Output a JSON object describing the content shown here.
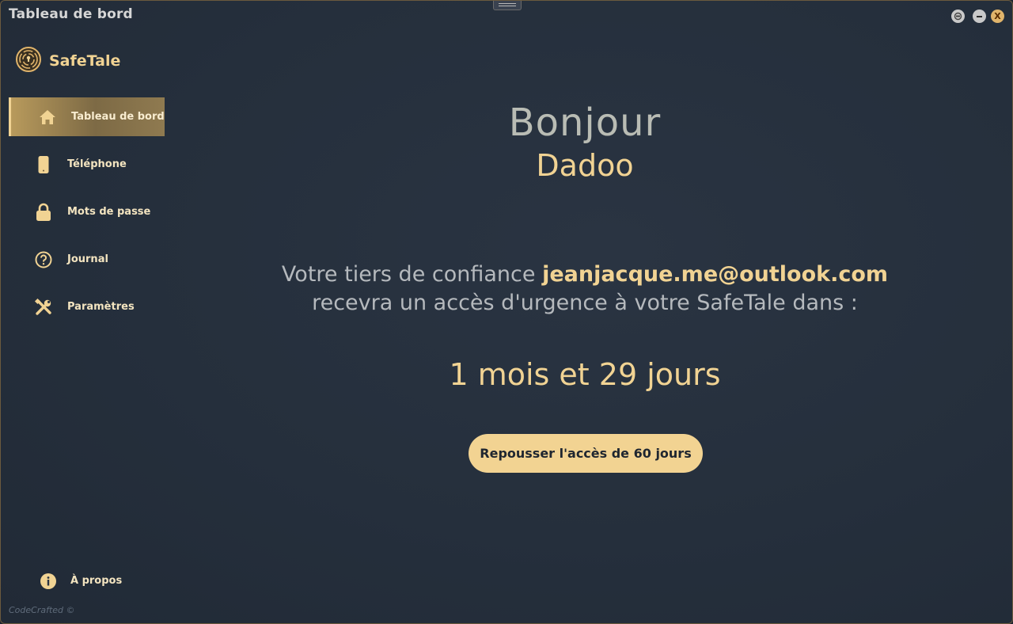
{
  "window": {
    "title": "Tableau de bord",
    "controls": {
      "extra_icon": "app-icon",
      "minimize_icon": "minimize-icon",
      "close_label": "X"
    }
  },
  "sidebar": {
    "brand": {
      "name": "SafeTale",
      "logo_icon": "safetale-logo-icon"
    },
    "items": [
      {
        "label": "Tableau de bord",
        "icon": "home-icon",
        "active": true
      },
      {
        "label": "Téléphone",
        "icon": "phone-icon",
        "active": false
      },
      {
        "label": "Mots de passe",
        "icon": "lock-icon",
        "active": false
      },
      {
        "label": "Journal",
        "icon": "question-circle-icon",
        "active": false
      },
      {
        "label": "Paramètres",
        "icon": "tools-icon",
        "active": false
      }
    ],
    "about": {
      "label": "À propos",
      "icon": "info-icon"
    },
    "credit": "CodeCrafted ©"
  },
  "main": {
    "greeting": "Bonjour",
    "username": "Dadoo",
    "message_prefix": "Votre tiers de confiance ",
    "trusted_email": "jeanjacque.me@outlook.com",
    "message_suffix": "recevra un accès d'urgence à votre SafeTale dans :",
    "countdown": "1 mois et 29 jours",
    "postpone_button": "Repousser l'accès de 60 jours"
  },
  "colors": {
    "accent": "#f1d393",
    "background": "#252f3c",
    "active_item": "#b89a5c",
    "button_bg": "#f2d392"
  }
}
